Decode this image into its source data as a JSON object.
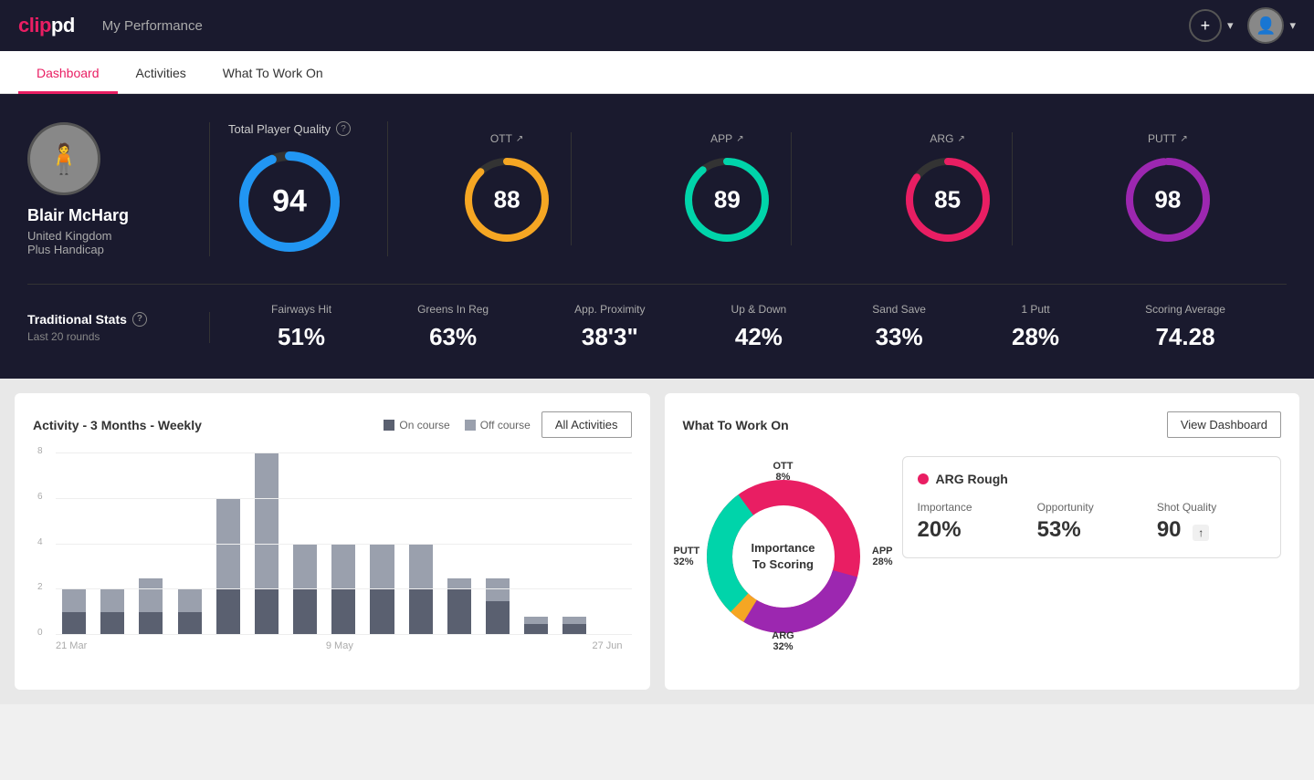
{
  "app": {
    "logo": "clippd",
    "header_title": "My Performance"
  },
  "nav": {
    "tabs": [
      {
        "id": "dashboard",
        "label": "Dashboard",
        "active": true
      },
      {
        "id": "activities",
        "label": "Activities",
        "active": false
      },
      {
        "id": "what-to-work-on",
        "label": "What To Work On",
        "active": false
      }
    ]
  },
  "player": {
    "name": "Blair McHarg",
    "country": "United Kingdom",
    "handicap": "Plus Handicap"
  },
  "total_quality": {
    "label": "Total Player Quality",
    "value": 94
  },
  "metrics": [
    {
      "id": "ott",
      "label": "OTT",
      "value": 88,
      "color": "#f5a623",
      "bg": "#1a1a2e",
      "track": "#333",
      "percent": 88
    },
    {
      "id": "app",
      "label": "APP",
      "value": 89,
      "color": "#00d4aa",
      "bg": "#1a1a2e",
      "track": "#333",
      "percent": 89
    },
    {
      "id": "arg",
      "label": "ARG",
      "value": 85,
      "color": "#e91e63",
      "bg": "#1a1a2e",
      "track": "#333",
      "percent": 85
    },
    {
      "id": "putt",
      "label": "PUTT",
      "value": 98,
      "color": "#9c27b0",
      "bg": "#1a1a2e",
      "track": "#333",
      "percent": 98
    }
  ],
  "trad_stats": {
    "label": "Traditional Stats",
    "period": "Last 20 rounds",
    "items": [
      {
        "label": "Fairways Hit",
        "value": "51%"
      },
      {
        "label": "Greens In Reg",
        "value": "63%"
      },
      {
        "label": "App. Proximity",
        "value": "38'3\""
      },
      {
        "label": "Up & Down",
        "value": "42%"
      },
      {
        "label": "Sand Save",
        "value": "33%"
      },
      {
        "label": "1 Putt",
        "value": "28%"
      },
      {
        "label": "Scoring Average",
        "value": "74.28"
      }
    ]
  },
  "activity_chart": {
    "title": "Activity - 3 Months - Weekly",
    "legend_on_course": "On course",
    "legend_off_course": "Off course",
    "all_activities_btn": "All Activities",
    "x_labels": [
      "21 Mar",
      "9 May",
      "27 Jun"
    ],
    "bars": [
      {
        "dark": 1,
        "light": 1
      },
      {
        "dark": 1,
        "light": 1
      },
      {
        "dark": 1,
        "light": 1.5
      },
      {
        "dark": 1,
        "light": 1
      },
      {
        "dark": 2,
        "light": 4
      },
      {
        "dark": 2,
        "light": 6
      },
      {
        "dark": 2,
        "light": 2
      },
      {
        "dark": 2,
        "light": 2
      },
      {
        "dark": 2,
        "light": 2
      },
      {
        "dark": 2,
        "light": 2
      },
      {
        "dark": 2,
        "light": 0.5
      },
      {
        "dark": 1.5,
        "light": 1
      },
      {
        "dark": 0.5,
        "light": 0.3
      },
      {
        "dark": 0.5,
        "light": 0.3
      },
      {
        "dark": 0,
        "light": 0
      }
    ],
    "y_labels": [
      "0",
      "2",
      "4",
      "6",
      "8"
    ]
  },
  "work_on": {
    "title": "What To Work On",
    "view_dashboard_btn": "View Dashboard",
    "donut_center": "Importance\nTo Scoring",
    "segments": [
      {
        "label": "OTT",
        "percent": "8%",
        "color": "#f5a623"
      },
      {
        "label": "APP",
        "percent": "28%",
        "color": "#00d4aa"
      },
      {
        "label": "ARG",
        "percent": "32%",
        "color": "#e91e63"
      },
      {
        "label": "PUTT",
        "percent": "32%",
        "color": "#9c27b0"
      }
    ],
    "detail_card": {
      "title": "ARG Rough",
      "dot_color": "#e91e63",
      "metrics": [
        {
          "label": "Importance",
          "value": "20%"
        },
        {
          "label": "Opportunity",
          "value": "53%"
        },
        {
          "label": "Shot Quality",
          "value": "90"
        }
      ]
    }
  }
}
